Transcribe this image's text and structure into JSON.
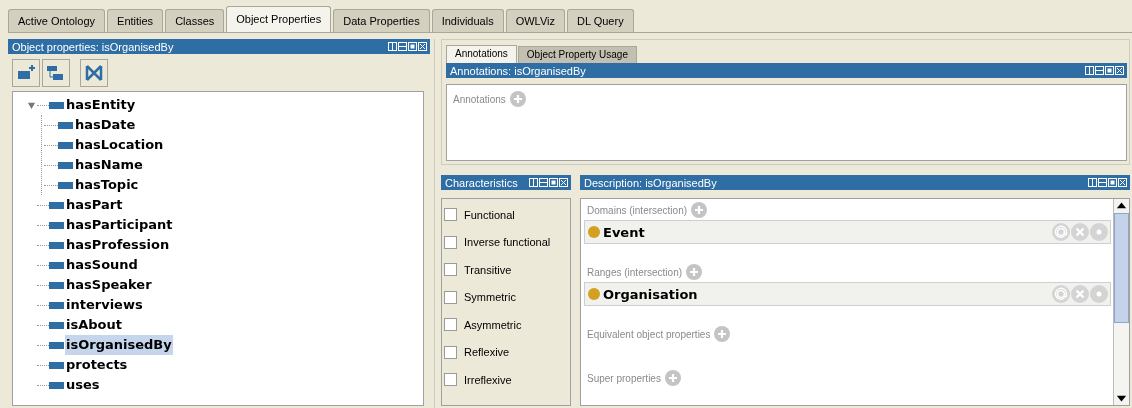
{
  "tabs": [
    {
      "label": "Active Ontology",
      "selected": false
    },
    {
      "label": "Entities",
      "selected": false
    },
    {
      "label": "Classes",
      "selected": false
    },
    {
      "label": "Object Properties",
      "selected": true
    },
    {
      "label": "Data Properties",
      "selected": false
    },
    {
      "label": "Individuals",
      "selected": false
    },
    {
      "label": "OWLViz",
      "selected": false
    },
    {
      "label": "DL Query",
      "selected": false
    }
  ],
  "hierarchy": {
    "title": "Object properties: isOrganisedBy",
    "tree": [
      {
        "label": "hasEntity",
        "selected": false,
        "expanded": true,
        "children": [
          {
            "label": "hasDate",
            "selected": false
          },
          {
            "label": "hasLocation",
            "selected": false
          },
          {
            "label": "hasName",
            "selected": false
          },
          {
            "label": "hasTopic",
            "selected": false
          }
        ]
      },
      {
        "label": "hasPart",
        "selected": false
      },
      {
        "label": "hasParticipant",
        "selected": false
      },
      {
        "label": "hasProfession",
        "selected": false
      },
      {
        "label": "hasSound",
        "selected": false
      },
      {
        "label": "hasSpeaker",
        "selected": false
      },
      {
        "label": "interviews",
        "selected": false
      },
      {
        "label": "isAbout",
        "selected": false
      },
      {
        "label": "isOrganisedBy",
        "selected": true
      },
      {
        "label": "protects",
        "selected": false
      },
      {
        "label": "uses",
        "selected": false
      }
    ]
  },
  "view_tabs": [
    {
      "label": "Annotations",
      "selected": true
    },
    {
      "label": "Object Property Usage",
      "selected": false
    }
  ],
  "annotations": {
    "title": "Annotations: isOrganisedBy",
    "section": "Annotations"
  },
  "characteristics": {
    "title": "Characteristics",
    "items": [
      {
        "label": "Functional",
        "checked": false
      },
      {
        "label": "Inverse functional",
        "checked": false
      },
      {
        "label": "Transitive",
        "checked": false
      },
      {
        "label": "Symmetric",
        "checked": false
      },
      {
        "label": "Asymmetric",
        "checked": false
      },
      {
        "label": "Reflexive",
        "checked": false
      },
      {
        "label": "Irreflexive",
        "checked": false
      }
    ]
  },
  "description": {
    "title": "Description: isOrganisedBy",
    "sections": [
      {
        "label": "Domains (intersection)",
        "items": [
          "Event"
        ]
      },
      {
        "label": "Ranges (intersection)",
        "items": [
          "Organisation"
        ]
      },
      {
        "label": "Equivalent object properties"
      },
      {
        "label": "Super properties"
      }
    ]
  }
}
